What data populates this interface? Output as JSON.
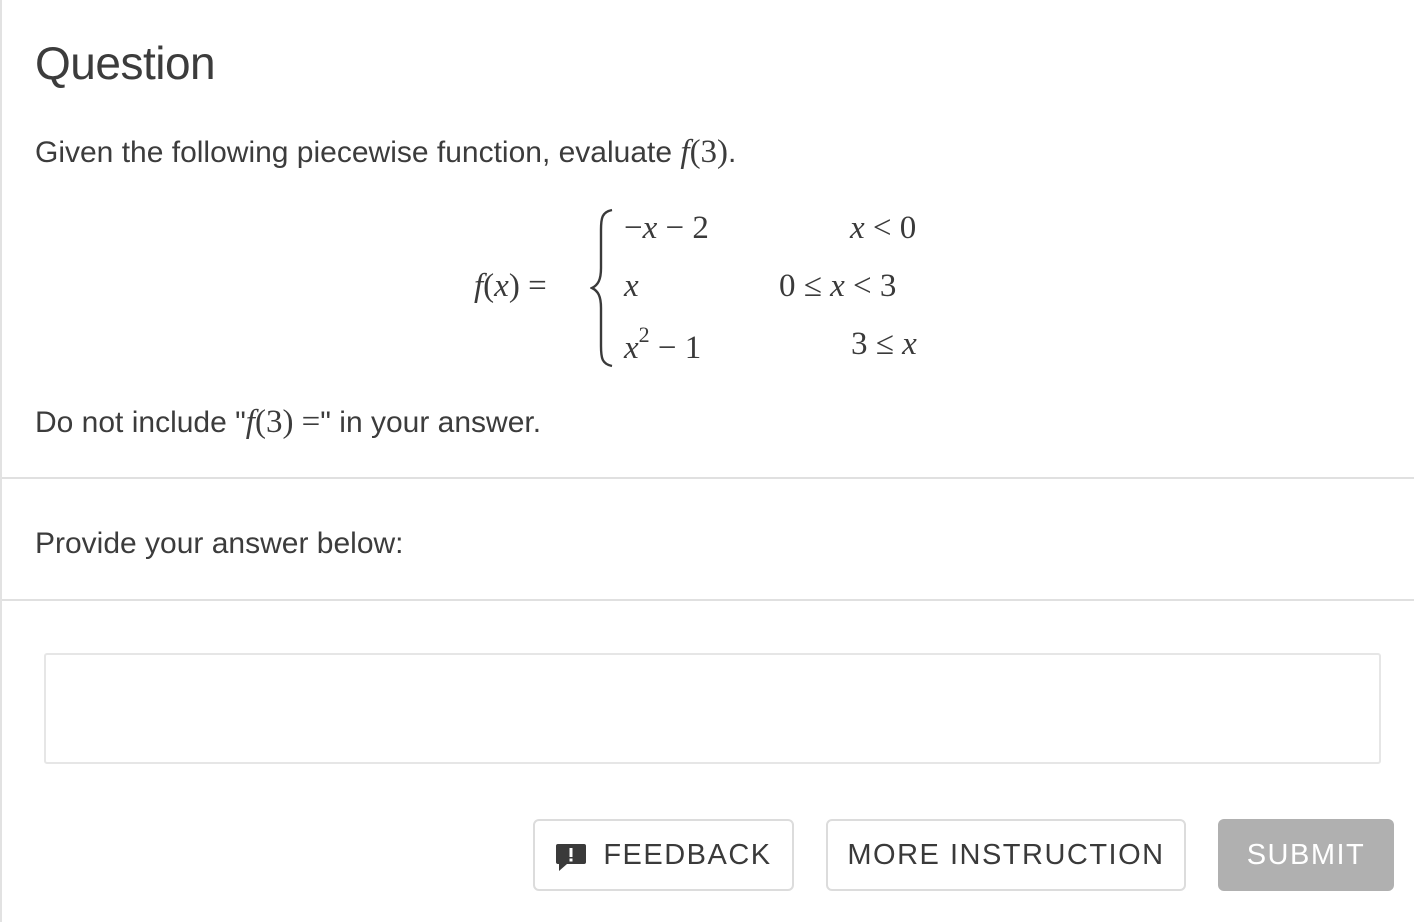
{
  "question": {
    "title": "Question",
    "prompt_text": "Given the following piecewise function, evaluate ",
    "prompt_math": "f(3)",
    "prompt_end": ".",
    "function_lhs": "f(x) =",
    "pieces": [
      {
        "expr": "−x − 2",
        "condition": "x < 0"
      },
      {
        "expr": "x",
        "condition": "0 ≤ x < 3"
      },
      {
        "expr": "x",
        "expr_sup": "2",
        "expr_tail": " − 1",
        "condition": "3 ≤ x"
      }
    ],
    "note_before": "Do not include \"",
    "note_math": "f(3) =",
    "note_after": "\" in your answer."
  },
  "answer": {
    "label": "Provide your answer below:",
    "value": "",
    "placeholder": ""
  },
  "buttons": {
    "feedback": "FEEDBACK",
    "more_instruction": "MORE INSTRUCTION",
    "submit": "SUBMIT"
  },
  "colors": {
    "submit_bg": "#b0b0b0",
    "divider": "#e0e0e0",
    "text": "#3c3c3c"
  },
  "icons": {
    "feedback": "exclamation-speech-bubble-icon"
  }
}
